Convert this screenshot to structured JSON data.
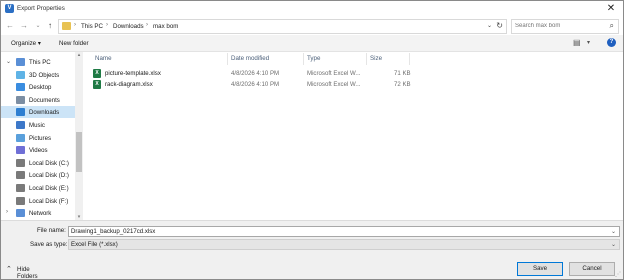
{
  "window": {
    "title": "Export Properties",
    "close_glyph": "✕"
  },
  "nav": {
    "back_glyph": "←",
    "forward_glyph": "→",
    "history_glyph": "⌄",
    "up_glyph": "↑",
    "breadcrumb": [
      "This PC",
      "Downloads",
      "max bom"
    ],
    "crumb_sep": "›",
    "dropdown_glyph": "⌄",
    "refresh_glyph": "↻",
    "search_placeholder": "Search max bom",
    "search_glyph": "⌕"
  },
  "toolbar": {
    "organize": "Organize ▾",
    "new_folder": "New folder",
    "help": "?",
    "view_glyph": "▤",
    "view_dd": "▾"
  },
  "sidebar": {
    "items": [
      {
        "label": "This PC",
        "icon": "pc-icon",
        "color": "#5a8fd6",
        "chev": "⌄",
        "selected": false
      },
      {
        "label": "3D Objects",
        "icon": "cube-icon",
        "color": "#5fb3e6",
        "chev": "",
        "selected": false
      },
      {
        "label": "Desktop",
        "icon": "desktop-icon",
        "color": "#3a8de0",
        "chev": "",
        "selected": false
      },
      {
        "label": "Documents",
        "icon": "documents-icon",
        "color": "#7c8ea3",
        "chev": "",
        "selected": false
      },
      {
        "label": "Downloads",
        "icon": "download-icon",
        "color": "#2f7fd1",
        "chev": "",
        "selected": true
      },
      {
        "label": "Music",
        "icon": "music-icon",
        "color": "#3d78c9",
        "chev": "",
        "selected": false
      },
      {
        "label": "Pictures",
        "icon": "pictures-icon",
        "color": "#5aa0dc",
        "chev": "",
        "selected": false
      },
      {
        "label": "Videos",
        "icon": "videos-icon",
        "color": "#6f6fd6",
        "chev": "",
        "selected": false
      },
      {
        "label": "Local Disk (C:)",
        "icon": "disk-icon",
        "color": "#7a7a7a",
        "chev": "",
        "selected": false
      },
      {
        "label": "Local Disk (D:)",
        "icon": "disk-icon",
        "color": "#7a7a7a",
        "chev": "",
        "selected": false
      },
      {
        "label": "Local Disk (E:)",
        "icon": "disk-icon",
        "color": "#7a7a7a",
        "chev": "",
        "selected": false
      },
      {
        "label": "Local Disk (F:)",
        "icon": "disk-icon",
        "color": "#7a7a7a",
        "chev": "",
        "selected": false
      },
      {
        "label": "Network",
        "icon": "network-icon",
        "color": "#5a8fd6",
        "chev": "›",
        "selected": false
      }
    ],
    "scroll_up": "▴",
    "scroll_down": "▾"
  },
  "files": {
    "columns": [
      "Name",
      "Date modified",
      "Type",
      "Size"
    ],
    "rows": [
      {
        "name": "picture-template.xlsx",
        "date": "4/8/2026 4:10 PM",
        "type": "Microsoft Excel W...",
        "size": "71 KB"
      },
      {
        "name": "rack-diagram.xlsx",
        "date": "4/8/2026 4:10 PM",
        "type": "Microsoft Excel W...",
        "size": "72 KB"
      }
    ],
    "file_icon_letter": "X"
  },
  "bottom": {
    "file_name_label": "File name:",
    "file_name_value": "Drawing1_backup_0217cd.xlsx",
    "save_type_label": "Save as type:",
    "save_type_value": "Excel File (*.xlsx)",
    "combo_glyph": "⌄",
    "hide_folders": "Hide Folders",
    "hide_glyph": "⌃",
    "save": "Save",
    "cancel": "Cancel"
  },
  "colors": {
    "accent": "#0078d7",
    "selection": "#cce4f7",
    "excel": "#1f7a45",
    "folder": "#e8c253"
  }
}
